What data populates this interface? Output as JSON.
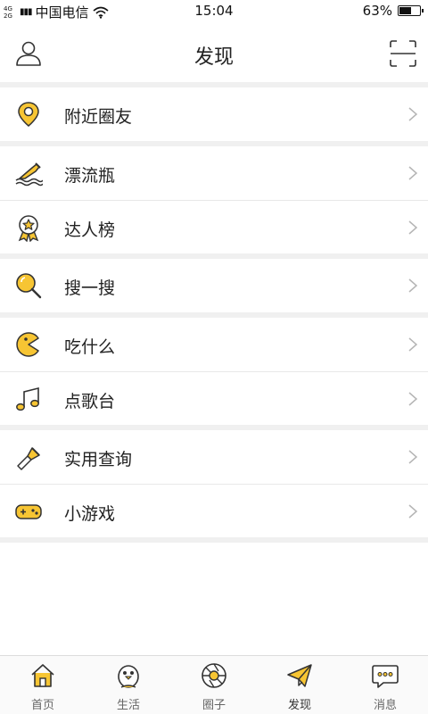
{
  "status_bar": {
    "network_top": "4G",
    "network_bottom": "2G",
    "carrier": "中国电信",
    "time": "15:04",
    "battery": "63%",
    "battery_level": 0.63
  },
  "navbar": {
    "title": "发现",
    "left_icon": "user-profile-icon",
    "right_icon": "scan-icon"
  },
  "menu": {
    "groups": [
      [
        {
          "label": "附近圈友",
          "icon": "location-pin-icon"
        }
      ],
      [
        {
          "label": "漂流瓶",
          "icon": "drift-bottle-icon"
        },
        {
          "label": "达人榜",
          "icon": "medal-star-icon"
        }
      ],
      [
        {
          "label": "搜一搜",
          "icon": "search-magnifier-icon"
        }
      ],
      [
        {
          "label": "吃什么",
          "icon": "pacman-icon"
        },
        {
          "label": "点歌台",
          "icon": "music-note-icon"
        }
      ],
      [
        {
          "label": "实用查询",
          "icon": "flashlight-icon"
        },
        {
          "label": "小游戏",
          "icon": "gamepad-icon"
        }
      ]
    ]
  },
  "tabs": [
    {
      "label": "首页",
      "icon": "home-icon",
      "active": false
    },
    {
      "label": "生活",
      "icon": "penguin-icon",
      "active": false
    },
    {
      "label": "圈子",
      "icon": "aperture-icon",
      "active": false
    },
    {
      "label": "发现",
      "icon": "paper-plane-icon",
      "active": true
    },
    {
      "label": "消息",
      "icon": "chat-bubble-icon",
      "active": false
    }
  ],
  "colors": {
    "accent": "#f7c533",
    "line": "#333333",
    "chevron": "#b5b5b5",
    "divider_band": "#f0f0f0"
  }
}
